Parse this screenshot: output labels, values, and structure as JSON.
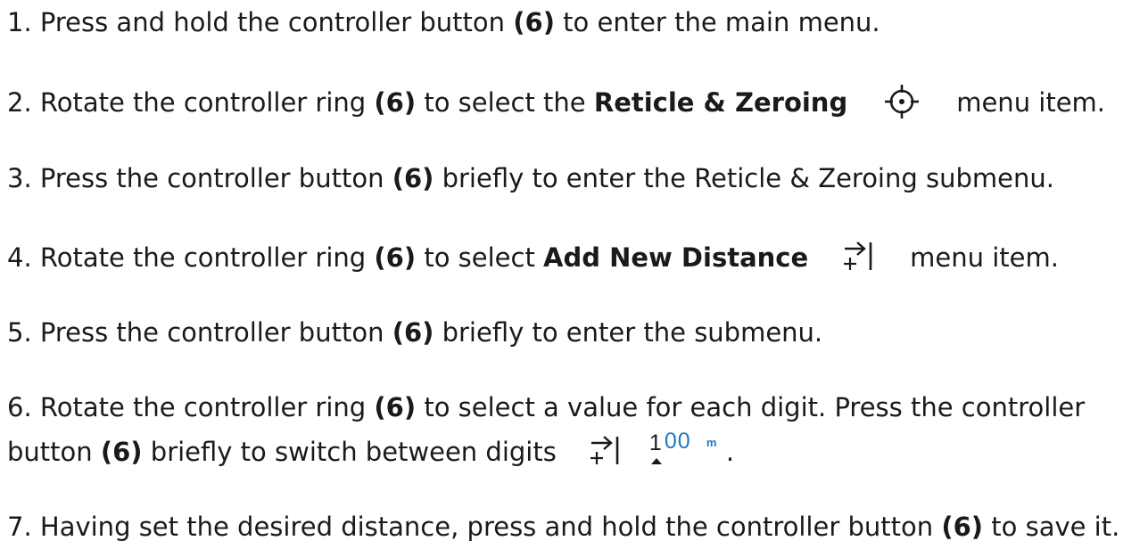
{
  "steps": [
    {
      "num": "1.",
      "parts": [
        " Press and hold the controller button ",
        "(6)",
        " to enter the main menu."
      ]
    },
    {
      "num": "2.",
      "parts": [
        " Rotate the controller ring ",
        "(6)",
        " to select the ",
        "Reticle & Zeroing",
        "menu item."
      ],
      "icon": "reticle-crosshair-icon"
    },
    {
      "num": "3.",
      "parts": [
        " Press the controller button ",
        "(6)",
        " briefly to enter the Reticle & Zeroing submenu."
      ]
    },
    {
      "num": "4.",
      "parts": [
        " Rotate the controller ring ",
        "(6)",
        " to select ",
        "Add New Distance",
        "menu item."
      ],
      "icon": "add-distance-icon"
    },
    {
      "num": "5.",
      "parts": [
        " Press the controller button ",
        "(6)",
        " briefly to enter the submenu."
      ]
    },
    {
      "num": "6.",
      "parts": [
        " Rotate the controller ring ",
        "(6)",
        " to select a value for each digit. Press the controller",
        "button ",
        "(6)",
        " briefly to switch between digits",
        "."
      ],
      "icon": "add-distance-icon",
      "readout": {
        "first_digit": "1",
        "other_digits": "00",
        "unit": "m"
      }
    },
    {
      "num": "7.",
      "parts": [
        " Having set the desired distance, press and hold the controller button ",
        "(6)",
        " to save it."
      ]
    }
  ],
  "colors": {
    "text": "#1a1a1a",
    "accent_blue": "#1e78c8"
  }
}
